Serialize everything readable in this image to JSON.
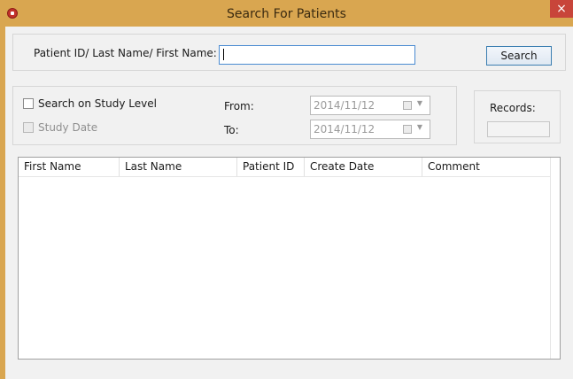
{
  "window": {
    "title": "Search For Patients",
    "close_glyph": "×"
  },
  "search": {
    "label": "Patient ID/ Last Name/ First Name:",
    "value": "",
    "button_label": "Search"
  },
  "study_filter": {
    "study_level_label": "Search on Study Level",
    "study_level_checked": false,
    "study_date_label": "Study Date",
    "study_date_checked": false,
    "from_label": "From:",
    "from_value": "2014/11/12",
    "to_label": "To:",
    "to_value": "2014/11/12",
    "dropdown_glyph": "▼"
  },
  "records": {
    "label": "Records:",
    "value": ""
  },
  "results_table": {
    "columns": [
      "First Name",
      "Last Name",
      "Patient ID",
      "Create Date",
      "Comment"
    ],
    "rows": []
  },
  "colors": {
    "titlebar": "#d9a650",
    "close": "#c8453a",
    "accent_border": "#4a8bd1"
  }
}
